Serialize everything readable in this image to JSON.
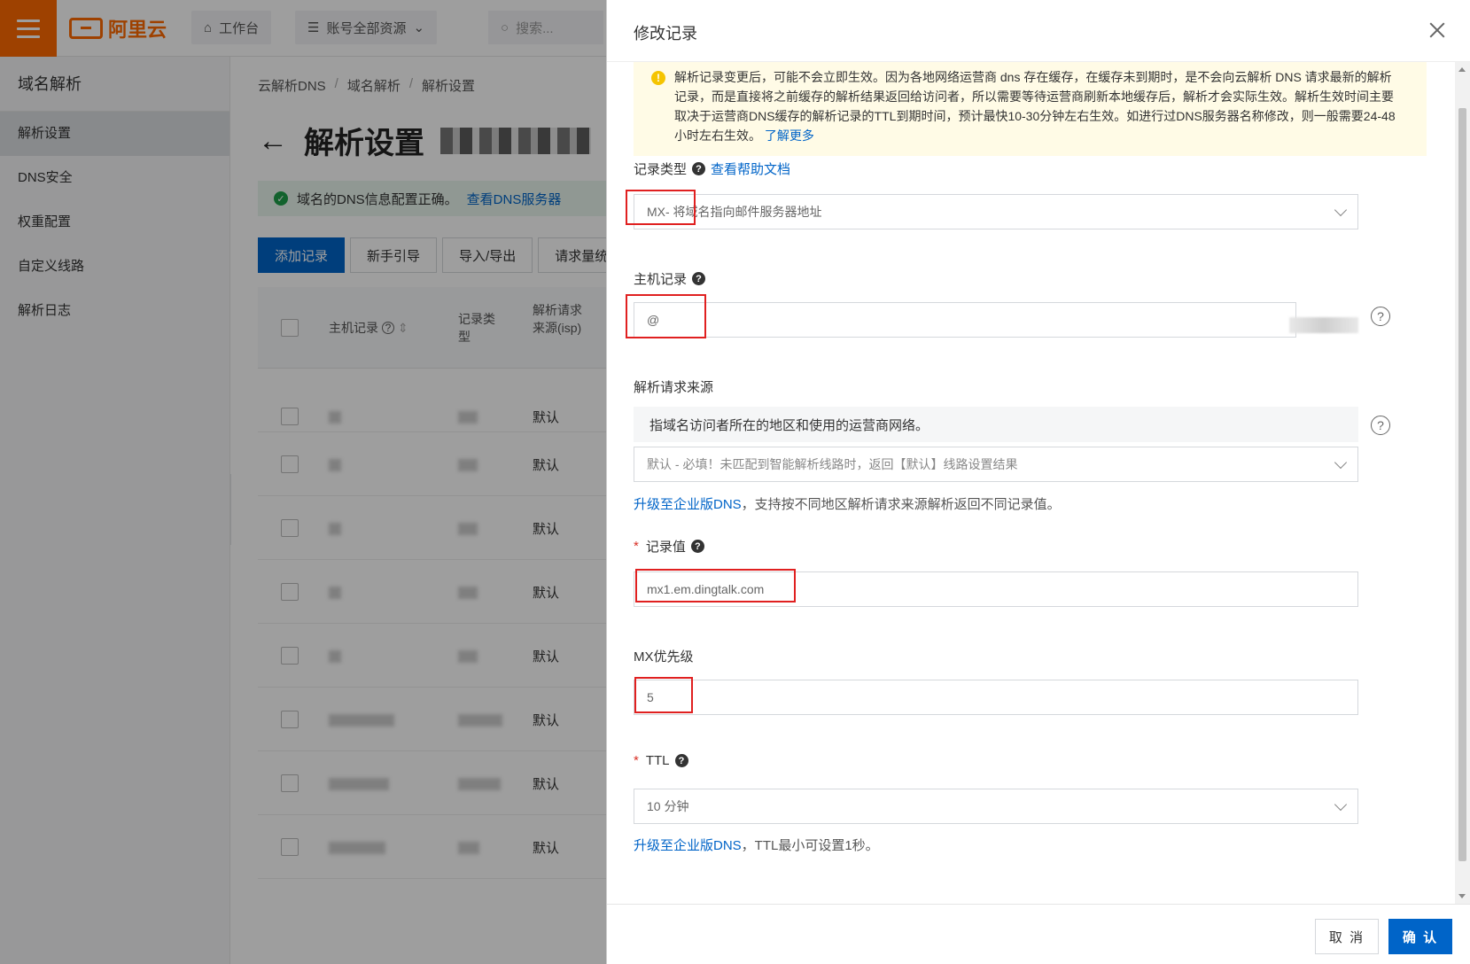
{
  "topbar": {
    "brand": "阿里云",
    "workbench": "工作台",
    "resources": "账号全部资源",
    "search_placeholder": "搜索..."
  },
  "sidebar": {
    "title": "域名解析",
    "items": [
      {
        "label": "解析设置",
        "active": true
      },
      {
        "label": "DNS安全"
      },
      {
        "label": "权重配置"
      },
      {
        "label": "自定义线路"
      },
      {
        "label": "解析日志"
      }
    ]
  },
  "main": {
    "breadcrumb": [
      "云解析DNS",
      "域名解析",
      "解析设置"
    ],
    "page_title": "解析设置",
    "notice_text": "域名的DNS信息配置正确。",
    "notice_link": "查看DNS服务器",
    "toolbar": [
      "添加记录",
      "新手引导",
      "导入/导出",
      "请求量统"
    ],
    "table": {
      "col_host": "主机记录",
      "col_type_1": "记录类",
      "col_type_2": "型",
      "col_line_1": "解析请求",
      "col_line_2": "来源(isp)",
      "rows_line": [
        "默认",
        "默认",
        "默认",
        "默认",
        "默认",
        "默认",
        "默认",
        "默认"
      ]
    }
  },
  "drawer": {
    "title": "修改记录",
    "warning": {
      "text": "解析记录变更后，可能不会立即生效。因为各地网络运营商 dns 存在缓存，在缓存未到期时，是不会向云解析 DNS 请求最新的解析记录，而是直接将之前缓存的解析结果返回给访问者，所以需要等待运营商刷新本地缓存后，解析才会实际生效。解析生效时间主要取决于运营商DNS缓存的解析记录的TTL到期时间，预计最快10-30分钟左右生效。如进行过DNS服务器名称修改，则一般需要24-48小时左右生效。",
      "link": "了解更多"
    },
    "record_type": {
      "label": "记录类型",
      "help_link": "查看帮助文档",
      "value": "MX- 将域名指向邮件服务器地址"
    },
    "host_record": {
      "label": "主机记录",
      "value": "@"
    },
    "line": {
      "label": "解析请求来源",
      "hint": "指域名访问者所在的地区和使用的运营商网络。",
      "value": "默认 - 必填！未匹配到智能解析线路时，返回【默认】线路设置结果",
      "upgrade_link": "升级至企业版DNS",
      "upgrade_text": "，支持按不同地区解析请求来源解析返回不同记录值。"
    },
    "record_value": {
      "label": "记录值",
      "value": "mx1.em.dingtalk.com"
    },
    "mx_priority": {
      "label": "MX优先级",
      "value": "5"
    },
    "ttl": {
      "label": "TTL",
      "value": "10 分钟",
      "upgrade_link": "升级至企业版DNS",
      "upgrade_text": "，TTL最小可设置1秒。"
    },
    "footer": {
      "cancel": "取 消",
      "confirm": "确 认"
    }
  }
}
